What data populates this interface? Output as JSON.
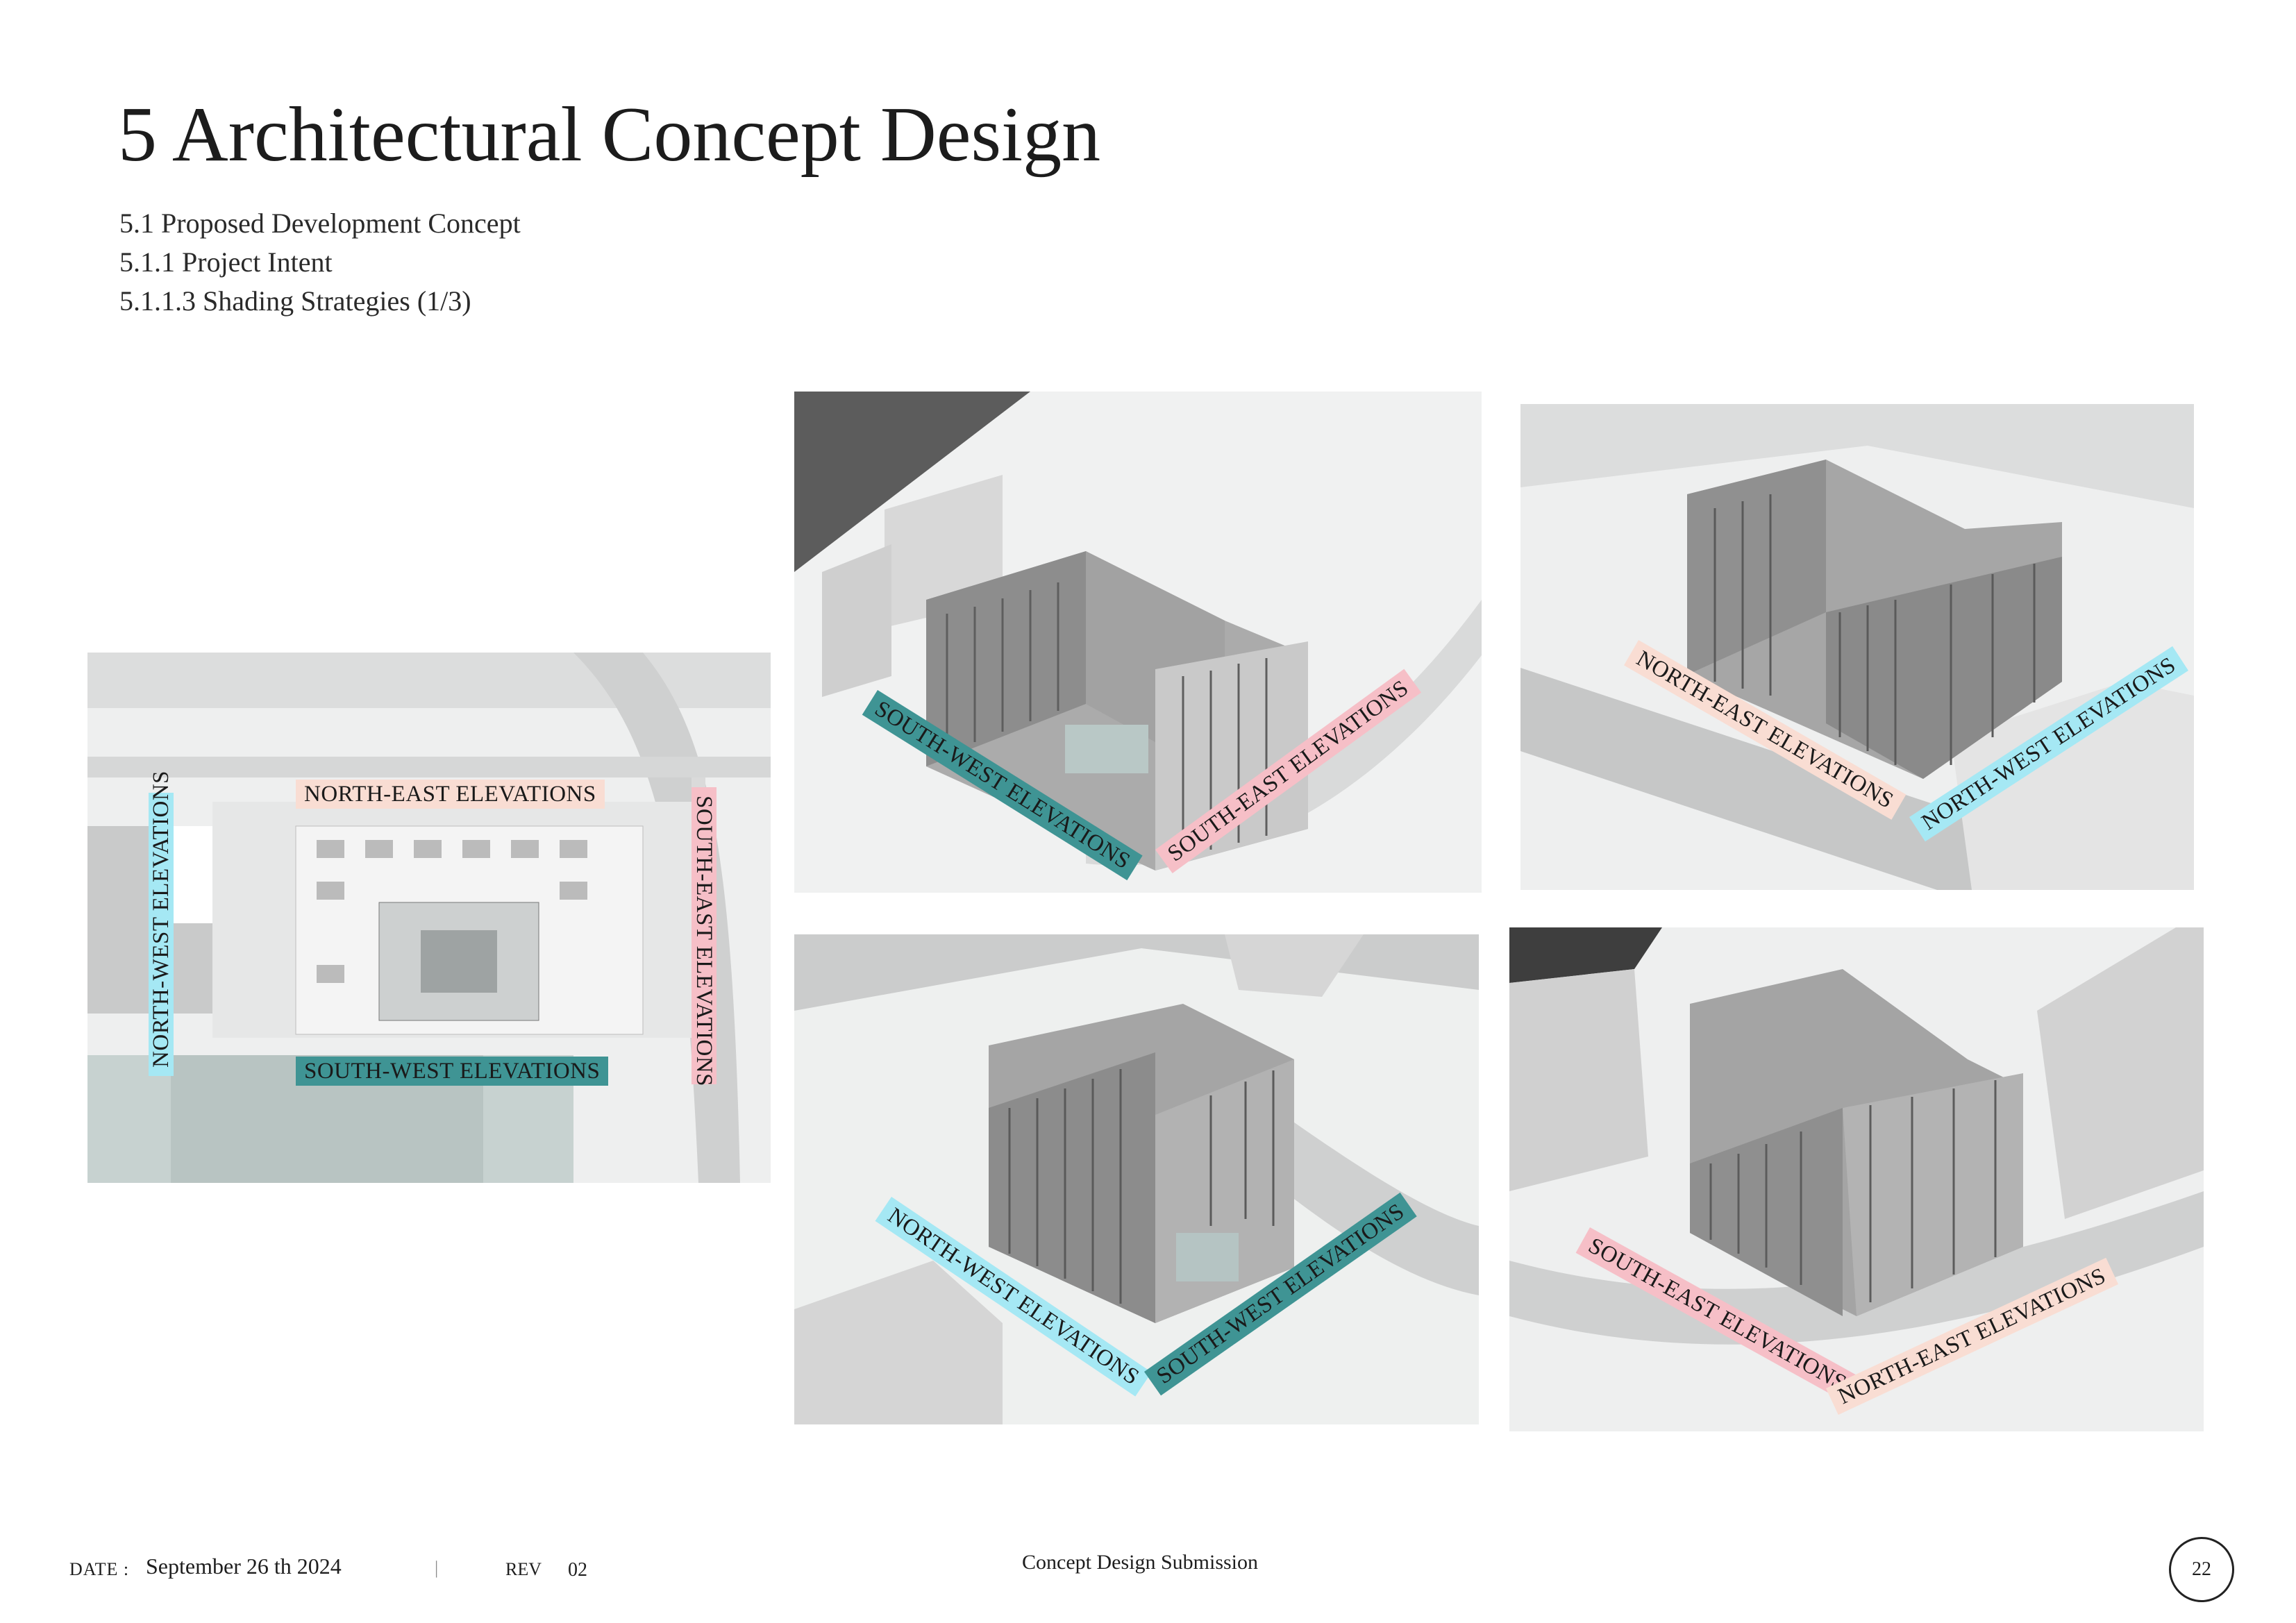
{
  "header": {
    "title": "5 Architectural Concept Design",
    "subheadings": [
      "5.1 Proposed Development Concept",
      "5.1.1 Project Intent",
      "5.1.1.3 Shading Strategies (1/3)"
    ]
  },
  "site_plan": {
    "labels": {
      "north_east": "NORTH-EAST ELEVATIONS",
      "north_west": "NORTH-WEST ELEVATIONS",
      "south_west": "SOUTH-WEST ELEVATIONS",
      "south_east": "SOUTH-EAST ELEVATIONS"
    }
  },
  "views": [
    {
      "labels": [
        "SOUTH-WEST ELEVATIONS",
        "SOUTH-EAST ELEVATIONS"
      ]
    },
    {
      "labels": [
        "NORTH-EAST ELEVATIONS",
        "NORTH-WEST ELEVATIONS"
      ]
    },
    {
      "labels": [
        "NORTH-WEST ELEVATIONS",
        "SOUTH-WEST ELEVATIONS"
      ]
    },
    {
      "labels": [
        "SOUTH-EAST ELEVATIONS",
        "NORTH-EAST ELEVATIONS"
      ]
    }
  ],
  "colors": {
    "south_west": "#3f9494",
    "south_east": "#f6bfc7",
    "north_east": "#f9ddd3",
    "north_west": "#a5e8f4"
  },
  "footer": {
    "date_label": "DATE :",
    "date_value": "September 26 th 2024",
    "separator": "|",
    "rev_label": "REV",
    "rev_value": "02",
    "document_title": "Concept Design Submission",
    "page_number": "22"
  }
}
